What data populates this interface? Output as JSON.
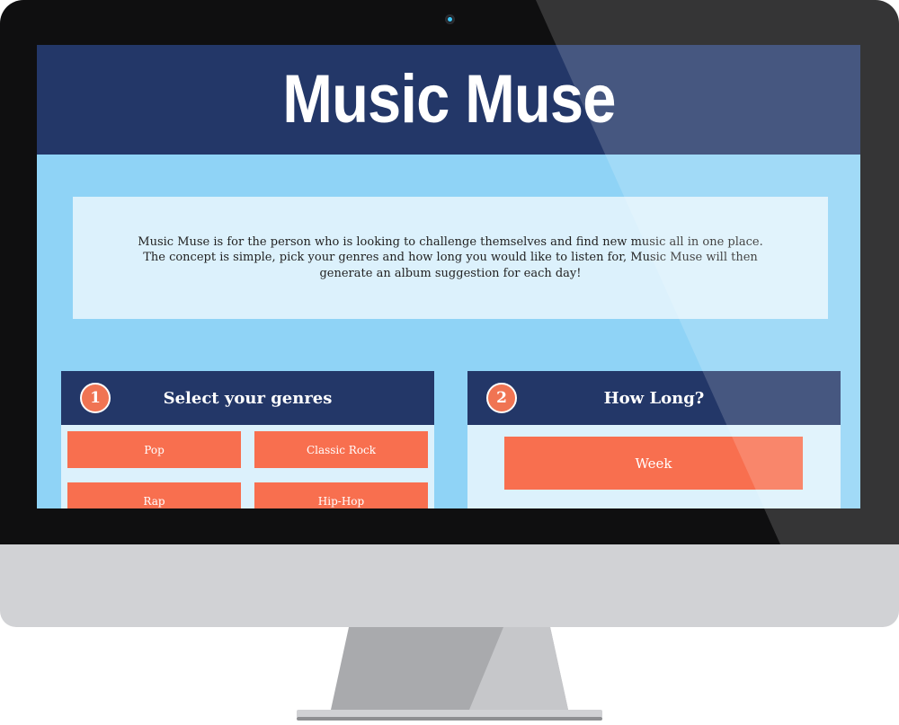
{
  "site": {
    "title": "Music Muse",
    "intro": "Music Muse is for the person who is looking to challenge themselves and find new music all in one place. The concept is simple, pick your genres and how long you would like to listen for, Music Muse will then generate an album suggestion for each day!"
  },
  "steps": [
    {
      "number": "1",
      "title": "Select your genres",
      "options": [
        "Pop",
        "Classic Rock",
        "Rap",
        "Hip-Hop"
      ]
    },
    {
      "number": "2",
      "title": "How Long?",
      "options": [
        "Week"
      ]
    }
  ],
  "colors": {
    "header": "#233768",
    "background": "#8fd3f6",
    "card": "#dcf1fc",
    "accent": "#f86f4f"
  },
  "icons": [
    "webcam-icon"
  ]
}
